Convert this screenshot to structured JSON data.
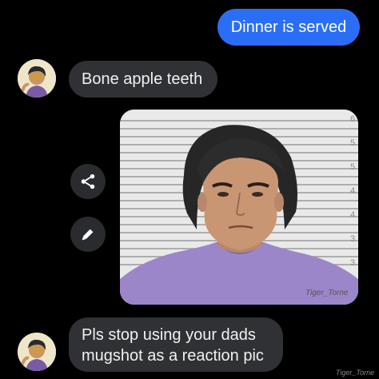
{
  "messages": {
    "sent_1": "Dinner is served",
    "received_1": "Bone apple teeth",
    "received_2_line1": "Pls stop using your dads",
    "received_2_line2": "mugshot as a reaction pic"
  },
  "image": {
    "height_marks": [
      "6",
      "5",
      "5",
      "4",
      "4",
      "3",
      "3"
    ],
    "signature": "Tiger_Torne",
    "shirt_color": "#9b86c9",
    "background_color": "#e7e7e7"
  },
  "icons": {
    "share": "share-icon",
    "edit": "pencil-icon"
  },
  "watermark": "Tiger_Torne",
  "colors": {
    "sent_bubble": "#2b6ef6",
    "received_bubble": "#303134",
    "background": "#000000"
  }
}
